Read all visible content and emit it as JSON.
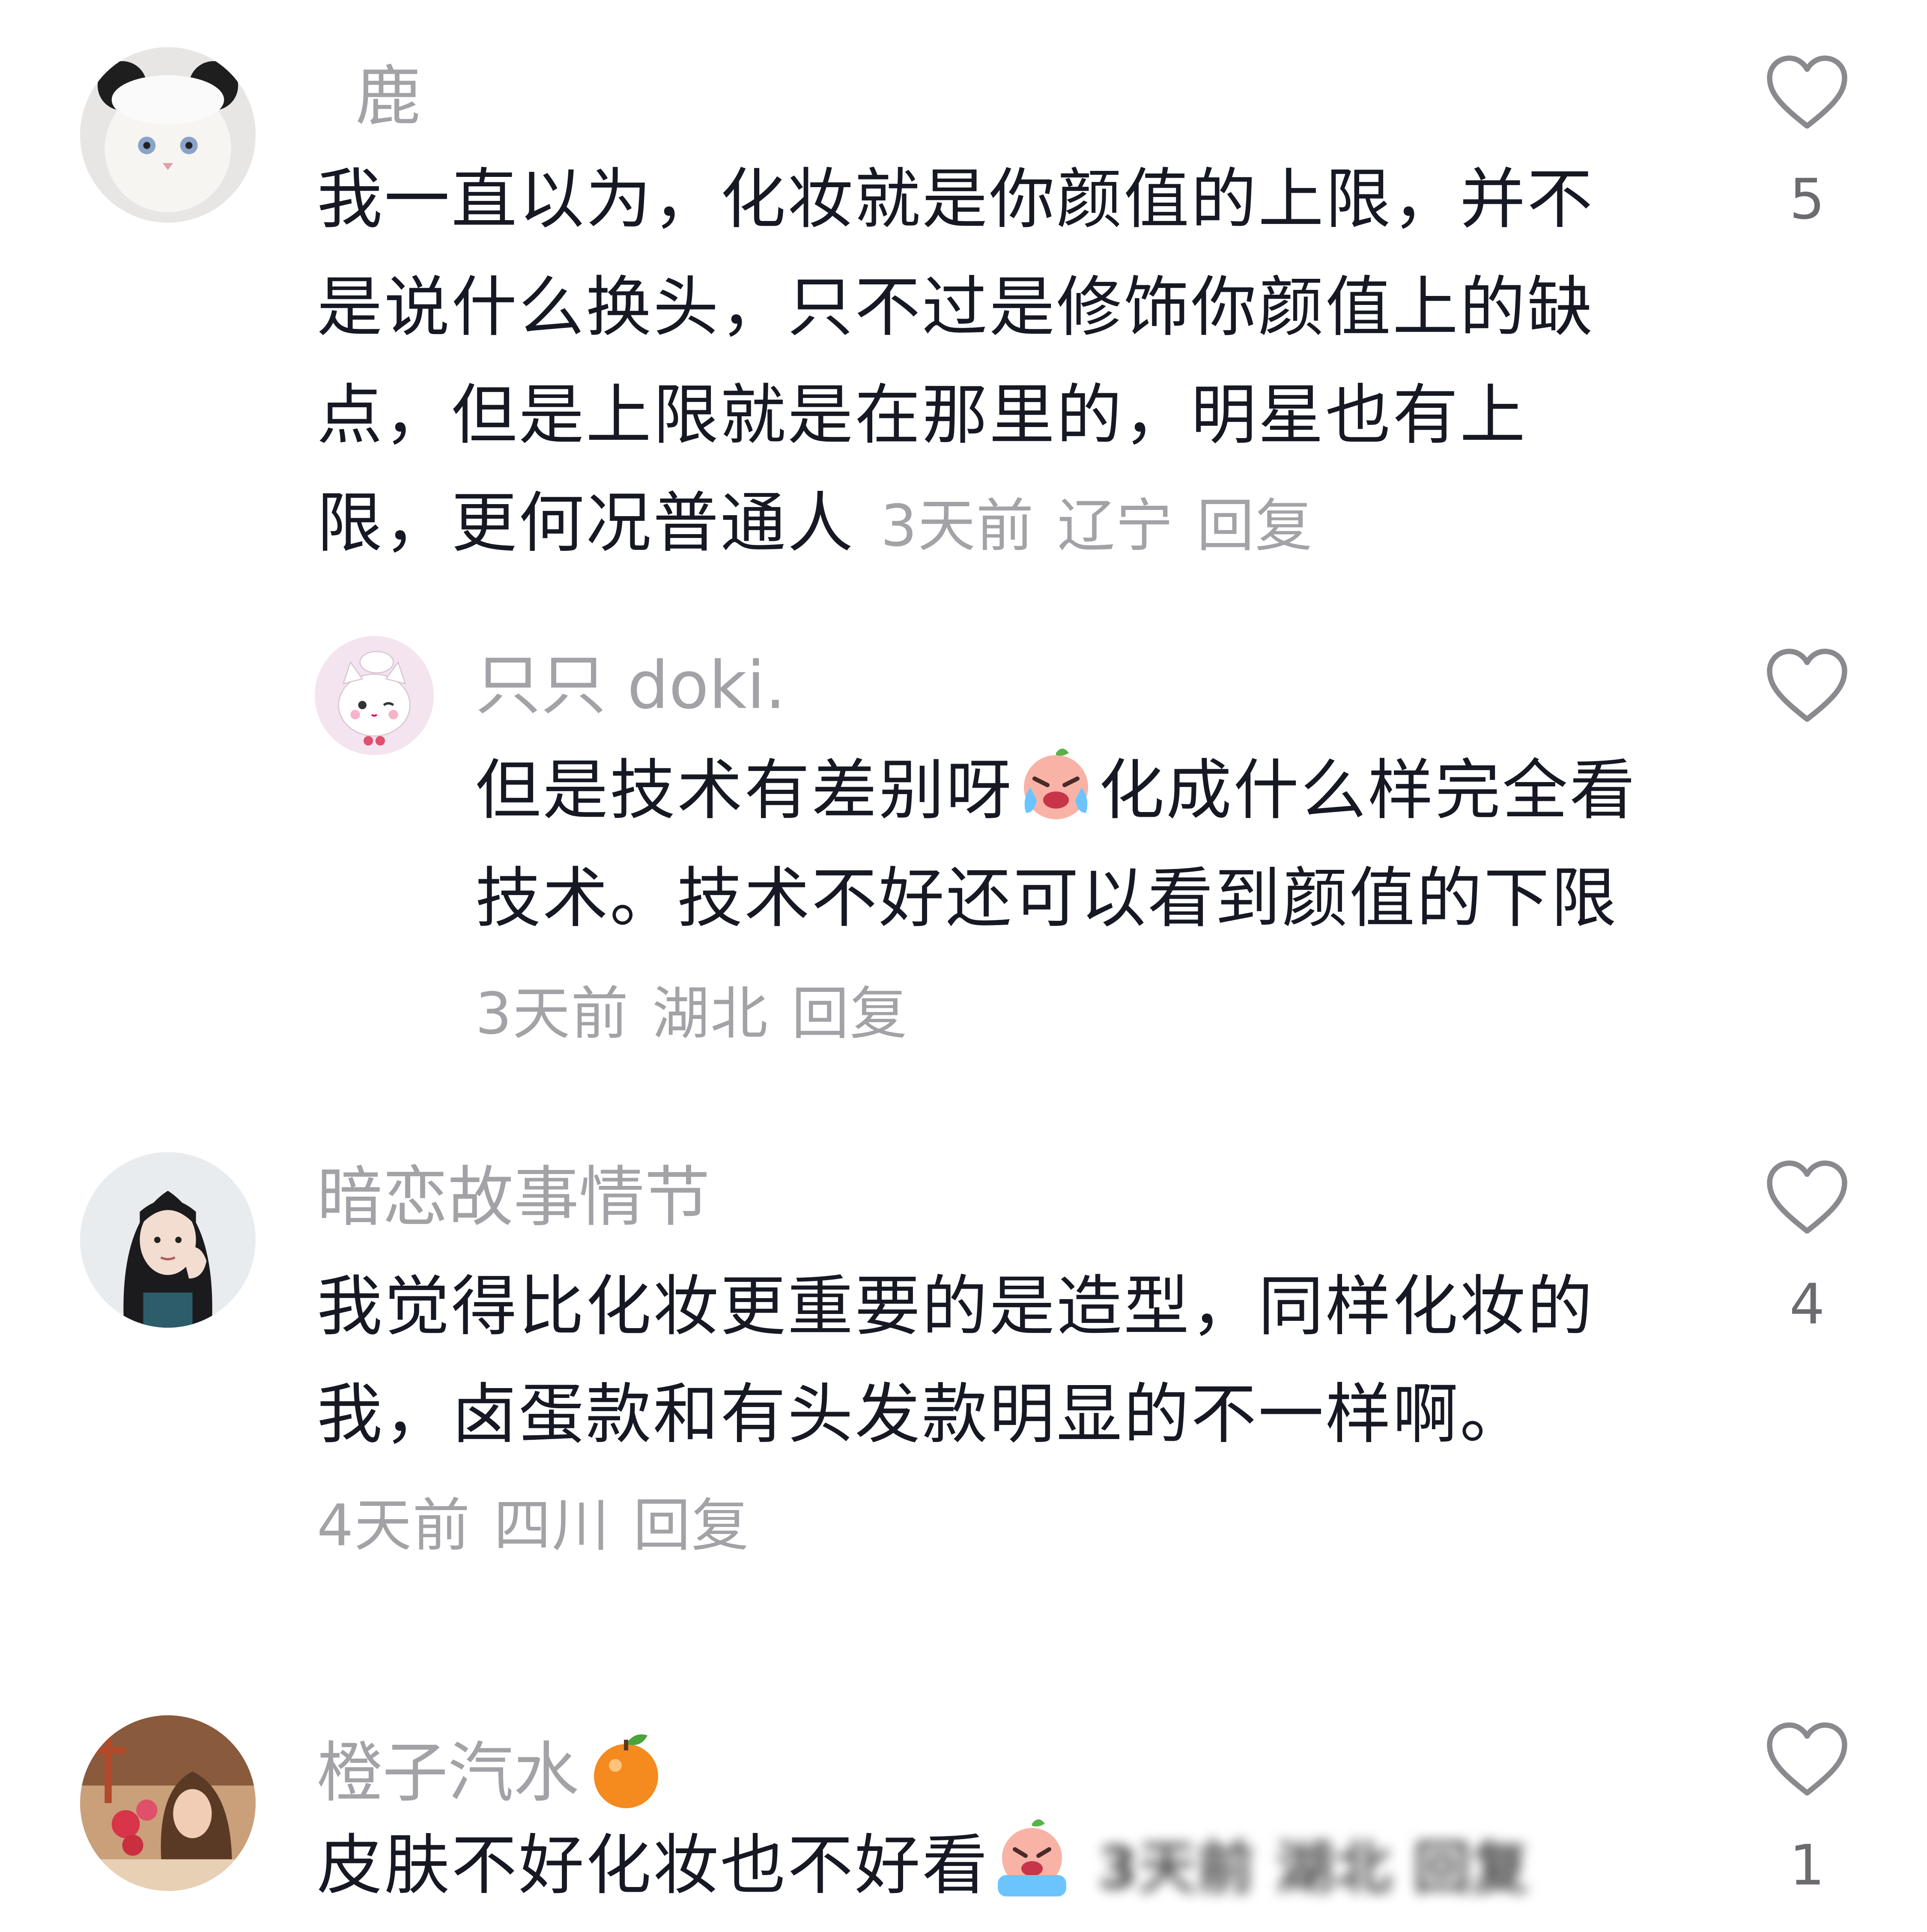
{
  "comments": [
    {
      "username": "鹿",
      "text": "我一直以为，化妆就是你颜值的上限，并不是说什么换头，只不过是修饰你颜值上的缺点，但是上限就是在那里的，明星也有上限，更何况普通人",
      "time": "3天前",
      "location": "辽宁",
      "reply_label": "回复",
      "likes": "5",
      "avatar_icon": "white-cat-with-panda-hat-avatar"
    },
    {
      "username": "只只 doki.",
      "text_before_emoji": "但是技术有差别呀",
      "emoji": "crying-face-emoji",
      "text_after_emoji": "化成什么样完全看技术。技术不好还可以看到颜值的下限",
      "time": "3天前",
      "location": "湖北",
      "reply_label": "回复",
      "likes": "",
      "avatar_icon": "cartoon-white-cat-chef-avatar"
    },
    {
      "username": "暗恋故事情节",
      "text": "我觉得比化妆更重要的是造型，同样化妆的我，卤蛋款和有头发款明显的不一样啊。",
      "time": "4天前",
      "location": "四川",
      "reply_label": "回复",
      "likes": "4",
      "avatar_icon": "girl-portrait-avatar"
    },
    {
      "username": "橙子汽水",
      "username_emoji": "orange-emoji",
      "text": "皮肤不好化妆也不好看",
      "emoji": "crying-face-emoji",
      "blurred_meta": "3天前 湖北 回复",
      "likes": "1",
      "avatar_icon": "girl-with-flowers-avatar"
    }
  ],
  "colors": {
    "text": "#161823",
    "meta": "#a2a2a7",
    "like_count": "#6b6b70"
  }
}
